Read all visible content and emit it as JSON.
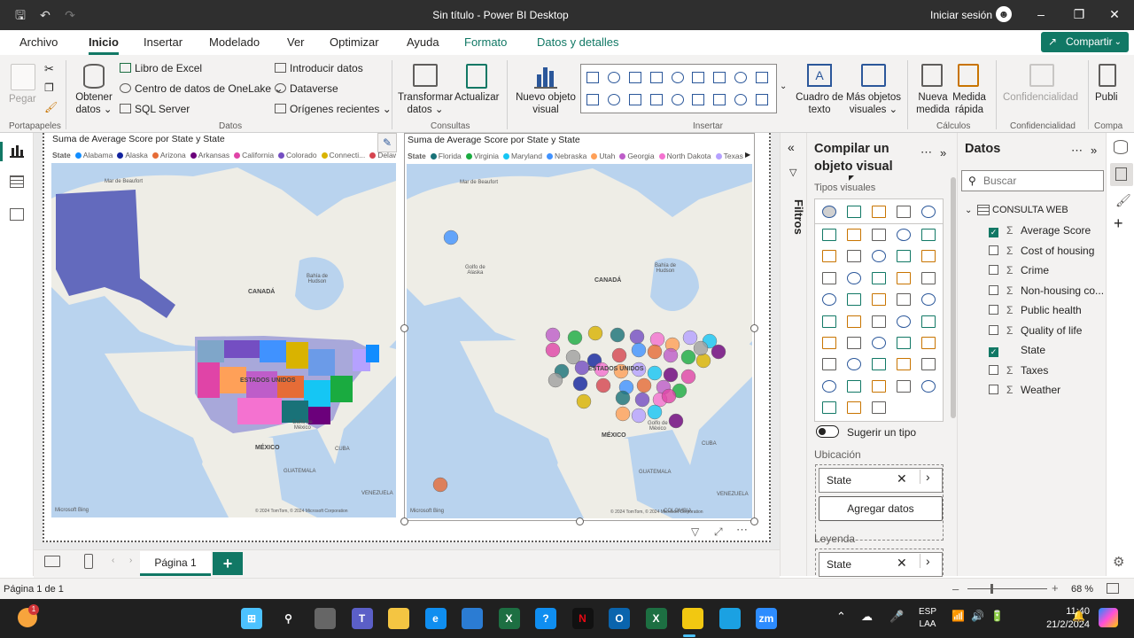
{
  "window": {
    "title": "Sin título - Power BI Desktop",
    "signin": "Iniciar sesión"
  },
  "tabs": [
    "Archivo",
    "Inicio",
    "Insertar",
    "Modelado",
    "Ver",
    "Optimizar",
    "Ayuda",
    "Formato",
    "Datos y detalles"
  ],
  "share_label": "Compartir",
  "ribbon": {
    "paste": "Pegar",
    "get_data": [
      "Obtener",
      "datos"
    ],
    "excel": "Libro de Excel",
    "onelake": "Centro de datos de OneLake",
    "sql": "SQL Server",
    "enter_data": "Introducir datos",
    "dataverse": "Dataverse",
    "recent": "Orígenes recientes",
    "transform": [
      "Transformar",
      "datos"
    ],
    "refresh": "Actualizar",
    "new_visual": [
      "Nuevo objeto",
      "visual"
    ],
    "textbox": [
      "Cuadro de",
      "texto"
    ],
    "more_visuals": [
      "Más objetos",
      "visuales"
    ],
    "new_measure": [
      "Nueva",
      "medida"
    ],
    "quick_measure": [
      "Medida",
      "rápida"
    ],
    "sensitivity": "Confidencialidad",
    "publish": "Publi",
    "groups": {
      "clipboard": "Portapapeles",
      "data": "Datos",
      "queries": "Consultas",
      "insert": "Insertar",
      "calc": "Cálculos",
      "sens": "Confidencialidad",
      "share": "Compa"
    }
  },
  "visual1": {
    "title": "Suma de Average Score por State y State",
    "legend_title": "State",
    "legend": [
      {
        "name": "Alabama",
        "color": "#118dff"
      },
      {
        "name": "Alaska",
        "color": "#12239e"
      },
      {
        "name": "Arizona",
        "color": "#e66c37"
      },
      {
        "name": "Arkansas",
        "color": "#6b007b"
      },
      {
        "name": "California",
        "color": "#e044a7"
      },
      {
        "name": "Colorado",
        "color": "#744ec2"
      },
      {
        "name": "Connecti...",
        "color": "#d9b300"
      },
      {
        "name": "Delaware",
        "color": "#d64550"
      }
    ]
  },
  "visual2": {
    "title": "Suma de Average Score por State y State",
    "legend_title": "State",
    "legend": [
      {
        "name": "Florida",
        "color": "#197278"
      },
      {
        "name": "Virginia",
        "color": "#1aab40"
      },
      {
        "name": "Maryland",
        "color": "#15c6f4"
      },
      {
        "name": "Nebraska",
        "color": "#4092ff"
      },
      {
        "name": "Utah",
        "color": "#ffa058"
      },
      {
        "name": "Georgia",
        "color": "#be5dc9"
      },
      {
        "name": "North Dakota",
        "color": "#f472d0"
      },
      {
        "name": "Texas",
        "color": "#b5a1ff"
      }
    ]
  },
  "map_labels": {
    "beaufort": "Mar de Beaufort",
    "canada": "CANADÁ",
    "hudson": [
      "Bahía de",
      "Hudson"
    ],
    "alaska_gulf": [
      "Golfo de",
      "Alaska"
    ],
    "usa": "ESTADOS UNIDOS",
    "mexico_gulf": [
      "Golfo de",
      "México"
    ],
    "mexico": "MÉXICO",
    "cuba": "CUBA",
    "guatemala": "GUATEMALA",
    "venezuela": "VENEZUELA",
    "colombia": "COLOMBIA",
    "copyright": "© 2024 TomTom, © 2024 Microsoft Corporation",
    "terms": "Terms",
    "bing": "Microsoft Bing"
  },
  "page_tab": "Página 1",
  "filters_label": "Filtros",
  "build": {
    "title": "Compilar un objeto visual",
    "visual_types": "Tipos visuales",
    "suggest": "Sugerir un tipo",
    "location": "Ubicación",
    "location_field": "State",
    "add_data": "Agregar datos",
    "legend": "Leyenda",
    "legend_field": "State"
  },
  "data_pane": {
    "title": "Datos",
    "search_placeholder": "Buscar",
    "table": "CONSULTA WEB",
    "fields": [
      {
        "name": "Average Score",
        "checked": true,
        "sigma": true
      },
      {
        "name": "Cost of housing",
        "checked": false,
        "sigma": true
      },
      {
        "name": "Crime",
        "checked": false,
        "sigma": true
      },
      {
        "name": "Non-housing co...",
        "checked": false,
        "sigma": true
      },
      {
        "name": "Public health",
        "checked": false,
        "sigma": true
      },
      {
        "name": "Quality of life",
        "checked": false,
        "sigma": true
      },
      {
        "name": "State",
        "checked": true,
        "sigma": false
      },
      {
        "name": "Taxes",
        "checked": false,
        "sigma": true
      },
      {
        "name": "Weather",
        "checked": false,
        "sigma": true
      }
    ]
  },
  "status": {
    "page": "Página 1 de 1",
    "zoom": "68 %"
  },
  "taskbar": {
    "lang": [
      "ESP",
      "LAA"
    ],
    "time": "11:40",
    "date": "21/2/2024",
    "badge": "1"
  }
}
